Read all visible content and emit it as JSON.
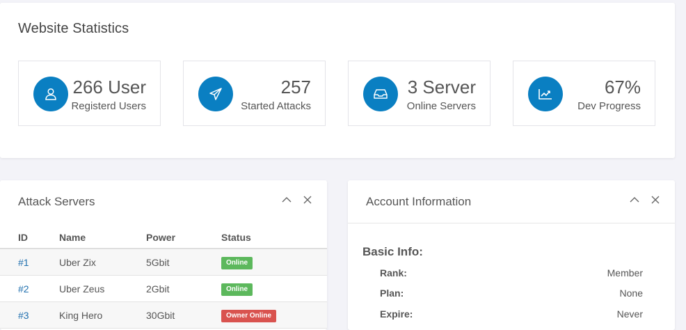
{
  "stats": {
    "title": "Website Statistics",
    "items": [
      {
        "value": "266 User",
        "label": "Registerd Users",
        "icon": "user-icon"
      },
      {
        "value": "257",
        "label": "Started Attacks",
        "icon": "paper-plane-icon"
      },
      {
        "value": "3 Server",
        "label": "Online Servers",
        "icon": "inbox-icon"
      },
      {
        "value": "67%",
        "label": "Dev Progress",
        "icon": "trend-chart-icon"
      }
    ]
  },
  "servers": {
    "title": "Attack Servers",
    "columns": [
      "ID",
      "Name",
      "Power",
      "Status"
    ],
    "rows": [
      {
        "id": "#1",
        "name": "Uber Zix",
        "power": "5Gbit",
        "status": "Online"
      },
      {
        "id": "#2",
        "name": "Uber Zeus",
        "power": "2Gbit",
        "status": "Online"
      },
      {
        "id": "#3",
        "name": "King Hero",
        "power": "30Gbit",
        "status": "Owner Online"
      }
    ]
  },
  "account": {
    "title": "Account Information",
    "section": "Basic Info:",
    "fields": [
      {
        "key": "Rank:",
        "value": "Member"
      },
      {
        "key": "Plan:",
        "value": "None"
      },
      {
        "key": "Expire:",
        "value": "Never"
      }
    ]
  },
  "colors": {
    "accent": "#0a7fc2",
    "online": "#5cb85c",
    "owner_online": "#d9534f",
    "link": "#1f6fae"
  }
}
